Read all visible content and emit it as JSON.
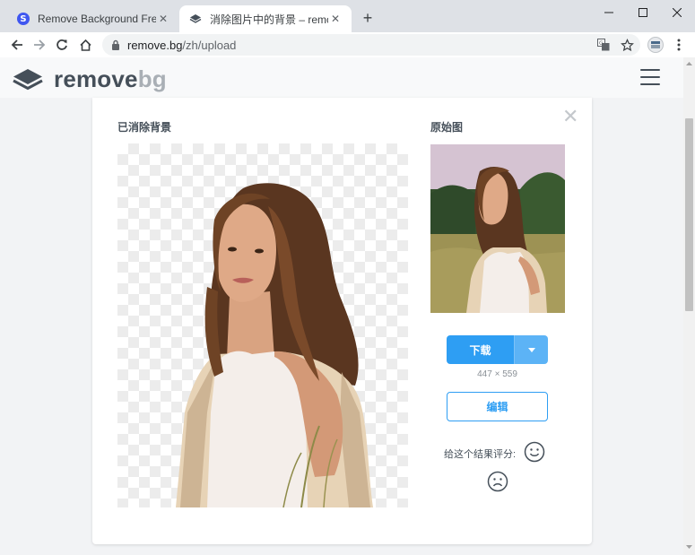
{
  "browser": {
    "tabs": [
      {
        "title": "Remove Background Free | Soc",
        "active": false
      },
      {
        "title": "消除图片中的背景 – remove.bg",
        "active": true
      }
    ],
    "new_tab": "+",
    "url_host": "remove.bg",
    "url_path": "/zh/upload"
  },
  "site": {
    "logo_remove": "remove",
    "logo_bg": "bg"
  },
  "card": {
    "result_label": "已消除背景",
    "original_label": "原始图",
    "close": "✕",
    "download_label": "下载",
    "dimensions": "447 × 559",
    "edit_label": "编辑",
    "rate_label": "给这个结果评分:"
  },
  "colors": {
    "accent": "#2e9ef3",
    "accent_light": "#5cb3f6",
    "logo_dark": "#454f59",
    "logo_light": "#a9afb5"
  }
}
